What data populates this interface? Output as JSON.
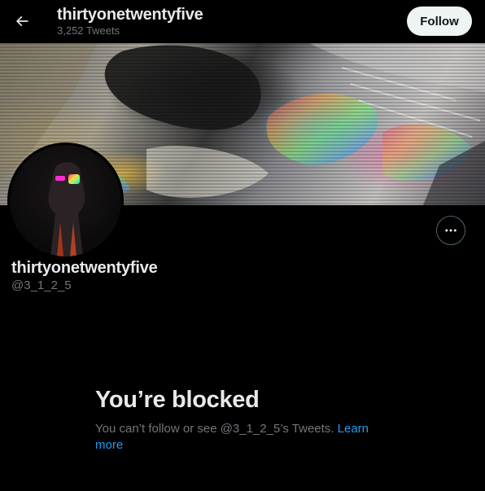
{
  "header": {
    "title": "thirtyonetwentyfive",
    "tweet_count": "3,252 Tweets",
    "follow_label": "Follow",
    "back_icon": "arrow-left-icon"
  },
  "profile": {
    "display_name": "thirtyonetwentyfive",
    "handle": "@3_1_2_5",
    "more_icon": "more-horizontal-icon"
  },
  "blocked": {
    "title": "You’re blocked",
    "message": "You can’t follow or see @3_1_2_5’s Tweets. ",
    "learn_more": "Learn more"
  },
  "colors": {
    "background": "#000000",
    "primary_text": "#e7e9ea",
    "secondary_text": "#71767b",
    "link": "#1d9bf0",
    "follow_button_bg": "#eff3f4"
  }
}
